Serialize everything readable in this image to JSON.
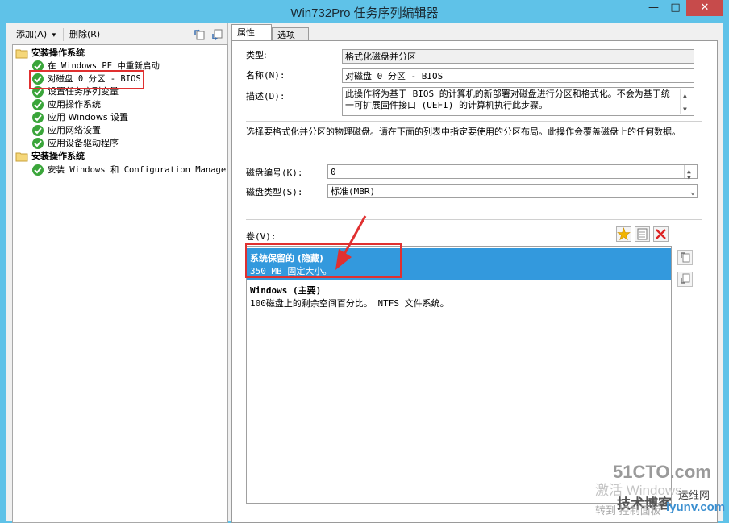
{
  "window": {
    "title": "Win732Pro 任务序列编辑器",
    "min": "—",
    "max": "□",
    "close": "✕"
  },
  "toolbar": {
    "add_label": "添加(A)",
    "add_caret": "▾",
    "delete_label": "删除(R)"
  },
  "tree": {
    "groups": [
      {
        "label": "安装操作系统",
        "items": [
          {
            "label": "在 Windows PE 中重新启动"
          },
          {
            "label": "对磁盘 0 分区 - BIOS"
          },
          {
            "label": "设置任务序列变量"
          },
          {
            "label": "应用操作系统"
          },
          {
            "label": "应用 Windows 设置"
          },
          {
            "label": "应用网络设置"
          },
          {
            "label": "应用设备驱动程序"
          }
        ]
      },
      {
        "label": "安装操作系统",
        "items": [
          {
            "label": "安装 Windows 和 Configuration Manager"
          }
        ]
      }
    ]
  },
  "tabs": {
    "properties": "属性",
    "options": "选项"
  },
  "form": {
    "type_label": "类型:",
    "type_value": "格式化磁盘并分区",
    "name_label": "名称(N):",
    "name_value": "对磁盘 0 分区 - BIOS",
    "desc_label": "描述(D):",
    "desc_value": "此操作将为基于 BIOS 的计算机的新部署对磁盘进行分区和格式化。不会为基于统一可扩展固件接口 (UEFI) 的计算机执行此步骤。",
    "instruction": "选择要格式化并分区的物理磁盘。请在下面的列表中指定要使用的分区布局。此操作会覆盖磁盘上的任何数据。",
    "disk_number_label": "磁盘编号(K):",
    "disk_number_value": "0",
    "disk_type_label": "磁盘类型(S):",
    "disk_type_value": "标准(MBR)",
    "volumes_label": "卷(V):"
  },
  "volumes": [
    {
      "name": "系统保留的 (隐藏)",
      "detail": "350 MB 固定大小。",
      "selected": true
    },
    {
      "name": "Windows (主要)",
      "detail": "100磁盘上的剩余空间百分比。 NTFS 文件系统。",
      "selected": false
    }
  ],
  "watermark": {
    "site": "51CTO.com",
    "line1": "激活 Windows",
    "line2": "技术博客",
    "line3": "转到 控制面板",
    "brand": "运维网",
    "url": "iyunv.com"
  },
  "colors": {
    "titlebar": "#5fc2e8",
    "selection": "#3399dd",
    "highlight_box": "#e03030",
    "check": "#3aa53a"
  }
}
